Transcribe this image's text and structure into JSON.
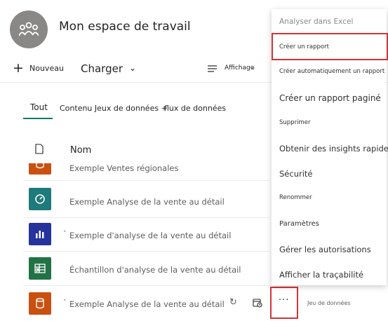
{
  "workspace": {
    "title": "Mon espace de travail",
    "icon": "people-icon"
  },
  "toolbar": {
    "new_label": "Nouveau",
    "upload_label": "Charger",
    "view_label": "Affichage"
  },
  "tabs": {
    "all": "Tout",
    "content": "Contenu Jeux de données +",
    "flows": "flux de données"
  },
  "table": {
    "name_header": "Nom",
    "rows": [
      {
        "name": "Exemple Ventes régionales",
        "icon": "database-icon",
        "color": "#ca5010"
      },
      {
        "name": "Exemple Analyse de la vente au détail",
        "icon": "dashboard-gauge-icon",
        "color": "#1e7b7b"
      },
      {
        "name": "Exemple d'analyse de la vente au détail",
        "icon": "bar-chart-icon",
        "color": "#26339c"
      },
      {
        "name": "Échantillon d'analyse de la vente au détail",
        "icon": "excel-icon",
        "color": "#217346"
      },
      {
        "name": "Exemple Analyse de la vente au détail",
        "icon": "database-icon",
        "color": "#ca5010",
        "type": "Jeu de données"
      }
    ]
  },
  "menu": {
    "items": [
      "Analyser dans Excel",
      "Créer un rapport",
      "Créer automatiquement un rapport",
      "Créer un rapport paginé",
      "Supprimer",
      "Obtenir des insights rapides",
      "Sécurité",
      "Renommer",
      "Paramètres",
      "Gérer les autorisations",
      "Afficher la traçabilité"
    ],
    "highlighted": "Créer un rapport"
  },
  "colors": {
    "accent": "#117865",
    "highlight_border": "#d13438"
  }
}
